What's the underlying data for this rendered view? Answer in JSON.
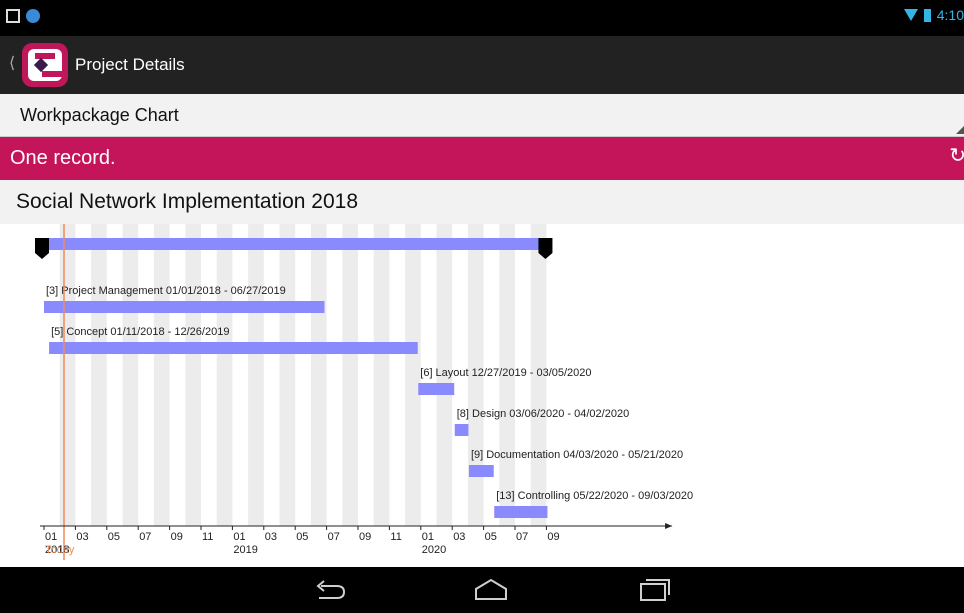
{
  "status_bar": {
    "time": "4:10"
  },
  "action_bar": {
    "title": "Project Details"
  },
  "selector": {
    "value": "Workpackage Chart"
  },
  "banner": {
    "message": "One record."
  },
  "project": {
    "title": "Social Network Implementation 2018"
  },
  "chart_data": {
    "type": "gantt",
    "x_axis": {
      "start": "2018-01",
      "end": "2020-09",
      "tick_labels": [
        "01",
        "03",
        "05",
        "07",
        "09",
        "11",
        "01",
        "03",
        "05",
        "07",
        "09",
        "11",
        "01",
        "03",
        "05",
        "07",
        "09"
      ],
      "year_labels": [
        "2018",
        "2019",
        "2020"
      ]
    },
    "today_label": "Today",
    "summary": {
      "start": "2018-01-01",
      "end": "2020-09-03"
    },
    "tasks": [
      {
        "label": "[3] Project Management 01/01/2018 - 06/27/2019",
        "start": "2018-01-01",
        "end": "2019-06-27"
      },
      {
        "label": "[5] Concept 01/11/2018 - 12/26/2019",
        "start": "2018-01-11",
        "end": "2019-12-26"
      },
      {
        "label": "[6] Layout 12/27/2019 - 03/05/2020",
        "start": "2019-12-27",
        "end": "2020-03-05"
      },
      {
        "label": "[8] Design 03/06/2020 - 04/02/2020",
        "start": "2020-03-06",
        "end": "2020-04-02"
      },
      {
        "label": "[9] Documentation 04/03/2020 - 05/21/2020",
        "start": "2020-04-03",
        "end": "2020-05-21"
      },
      {
        "label": "[13] Controlling 05/22/2020 - 09/03/2020",
        "start": "2020-05-22",
        "end": "2020-09-03"
      }
    ],
    "colors": {
      "bar": "#8a8aff",
      "stripe": "#ececec",
      "today": "#f08a5a",
      "milestone": "#000000"
    }
  }
}
